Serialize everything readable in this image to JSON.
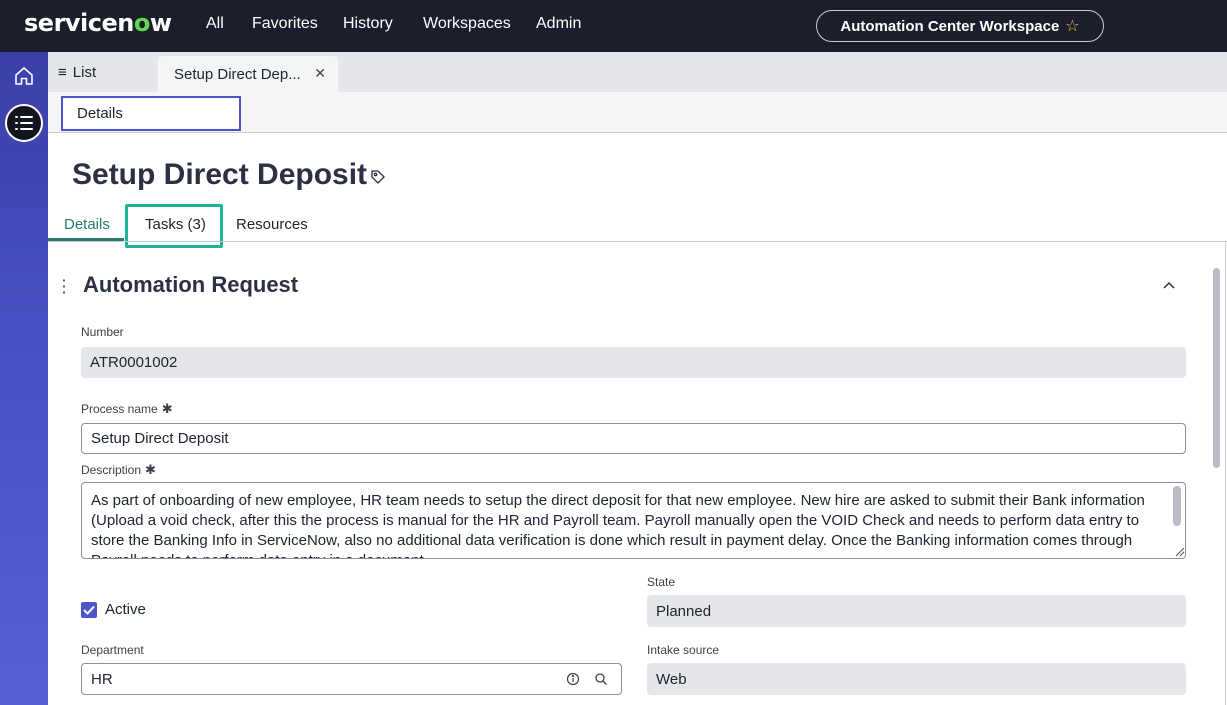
{
  "header": {
    "logo_text_pre": "servicen",
    "logo_text_o": "o",
    "logo_text_post": "w",
    "nav": [
      "All",
      "Favorites",
      "History",
      "Workspaces",
      "Admin"
    ],
    "workspace": "Automation Center Workspace"
  },
  "tabs": {
    "list_label": "List",
    "record_tab_label": "Setup Direct Dep..."
  },
  "subtab": {
    "label": "Details"
  },
  "record": {
    "title": "Setup Direct Deposit",
    "tabs": [
      "Details",
      "Tasks (3)",
      "Resources"
    ]
  },
  "form": {
    "section_title": "Automation Request",
    "number_label": "Number",
    "number_value": "ATR0001002",
    "process_name_label": "Process name",
    "process_name_value": "Setup Direct Deposit",
    "description_label": "Description",
    "description_value": "As part of onboarding of new employee, HR team needs to setup the direct deposit for that new employee. New hire are asked to submit their Bank information (Upload a void check, after this the process is manual for the HR and Payroll team. Payroll manually open the VOID Check and needs to perform data entry to store the Banking Info in ServiceNow, also no additional data verification is done which result in payment delay.  Once the Banking information comes through Payroll needs to perform data entry in a document.",
    "active_label": "Active",
    "active_checked": true,
    "state_label": "State",
    "state_value": "Planned",
    "department_label": "Department",
    "department_value": "HR",
    "intake_label": "Intake source",
    "intake_value": "Web"
  },
  "colors": {
    "header_bg": "#1b1e2b",
    "accent": "#4b55c9",
    "tab_active": "#2b7a6c",
    "highlight": "#1fb39a",
    "logo_o": "#62d84e"
  }
}
